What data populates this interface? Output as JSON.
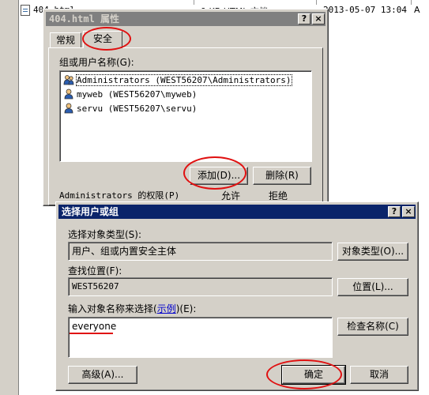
{
  "background": {
    "file_name": "404.html",
    "file_meta": "9 KB  HTML 文档",
    "file_date": "2013-05-07 13:04",
    "file_attr": "A"
  },
  "props_dialog": {
    "title": "404.html 属性",
    "help_btn": "?",
    "close_btn": "×",
    "tabs": [
      "常规",
      "安全"
    ],
    "group_label": "组或用户名称(G):",
    "users": [
      {
        "name": "Administrators (WEST56207\\Administrators)",
        "icon": "user-group-icon"
      },
      {
        "name": "myweb (WEST56207\\myweb)",
        "icon": "user-icon"
      },
      {
        "name": "servu (WEST56207\\servu)",
        "icon": "user-icon"
      }
    ],
    "add_button": "添加(D)...",
    "remove_button": "删除(R)",
    "permissions_label": "Administrators 的权限(P)",
    "allow_header": "允许",
    "deny_header": "拒绝"
  },
  "select_dialog": {
    "title": "选择用户或组",
    "help_btn": "?",
    "close_btn": "×",
    "object_type_label": "选择对象类型(S):",
    "object_type_value": "用户、组或内置安全主体",
    "object_type_button": "对象类型(O)...",
    "location_label": "查找位置(F):",
    "location_value": "WEST56207",
    "location_button": "位置(L)...",
    "input_label_prefix": "输入对象名称来选择(",
    "input_label_link": "示例",
    "input_label_suffix": ")(E):",
    "input_value": "everyone",
    "check_names_button": "检查名称(C)",
    "advanced_button": "高级(A)...",
    "ok_button": "确定",
    "cancel_button": "取消"
  },
  "colors": {
    "annotation": "#e01010",
    "active_title": "#0a246a",
    "inactive_title": "#808080"
  }
}
